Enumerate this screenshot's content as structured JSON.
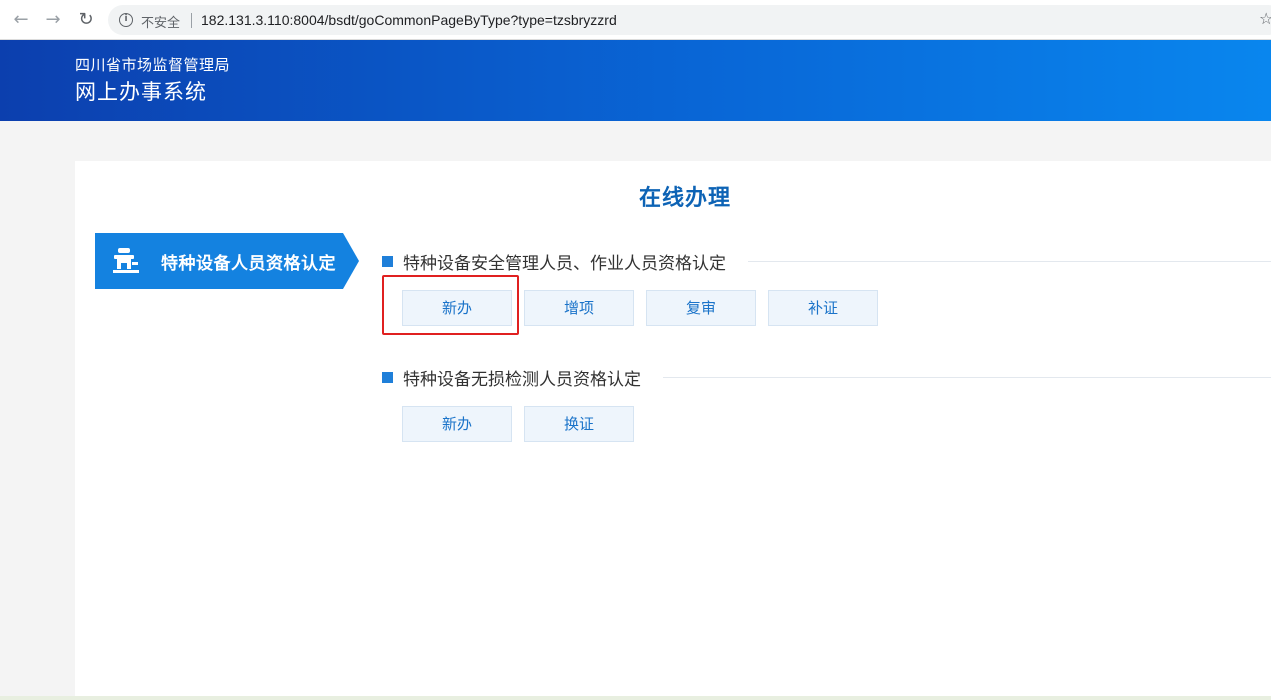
{
  "browser": {
    "security_label": "不安全",
    "url": "182.131.3.110:8004/bsdt/goCommonPageByType?type=tzsbryzzrd"
  },
  "header": {
    "org_name": "四川省市场监督管理局",
    "system_name": "网上办事系统"
  },
  "main": {
    "title": "在线办理",
    "left_tab": {
      "label": "特种设备人员资格认定",
      "icon": "equipment-icon"
    },
    "sections": [
      {
        "title": "特种设备安全管理人员、作业人员资格认定",
        "buttons": [
          "新办",
          "增项",
          "复审",
          "补证"
        ]
      },
      {
        "title": "特种设备无损检测人员资格认定",
        "buttons": [
          "新办",
          "换证"
        ]
      }
    ]
  },
  "colors": {
    "accent": "#1482e0",
    "title_blue": "#0d63b5",
    "highlight_red": "#e02020"
  }
}
